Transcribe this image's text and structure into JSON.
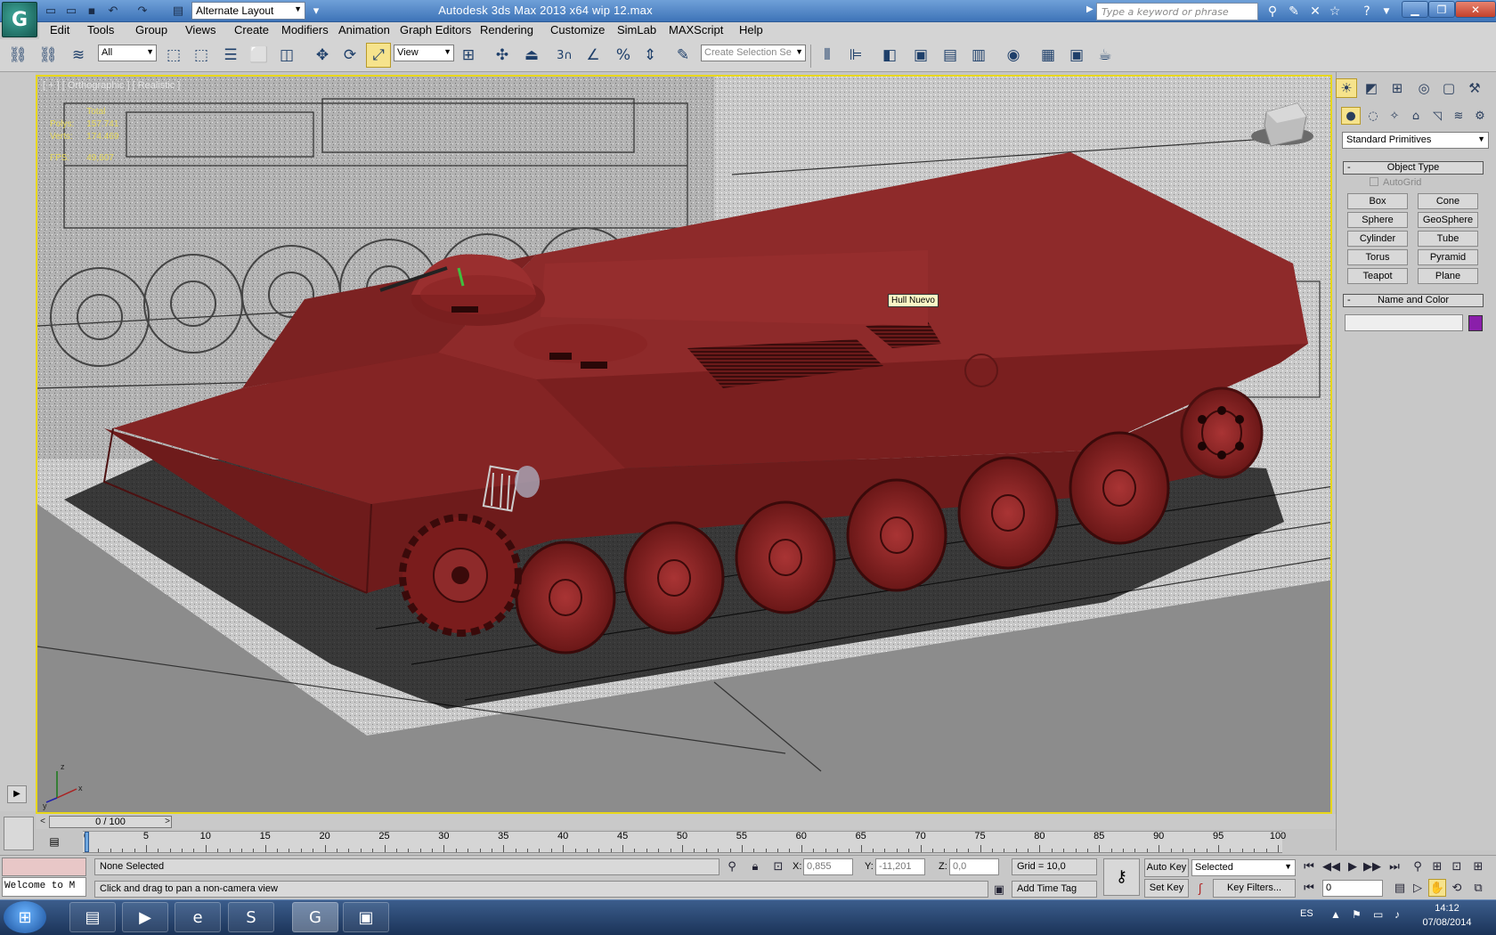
{
  "window": {
    "title": "Autodesk 3ds Max  2013 x64       wip 12.max",
    "layout": "Alternate Layout",
    "search_placeholder": "Type a keyword or phrase"
  },
  "menu": [
    "Edit",
    "Tools",
    "Group",
    "Views",
    "Create",
    "Modifiers",
    "Animation",
    "Graph Editors",
    "Rendering",
    "Customize",
    "SimLab",
    "MAXScript",
    "Help"
  ],
  "toolbar": {
    "filter": "All",
    "ref_coord": "View",
    "selection_set_placeholder": "Create Selection Se",
    "snap_value": "3"
  },
  "viewport": {
    "label": "[ + ] [ Orthographic ] [ Realistic ]",
    "stats": {
      "header": "Total",
      "polys_label": "Polys:",
      "polys": "157.741",
      "verts_label": "Verts:",
      "verts": "174.469",
      "fps_label": "FPS:",
      "fps": "49,607"
    },
    "tooltip": "Hull Nuevo",
    "colors": {
      "hull": "#8e2a2a",
      "border": "#e8d71b"
    }
  },
  "command_panel": {
    "category": "Standard Primitives",
    "object_type_title": "Object Type",
    "autogrid": "AutoGrid",
    "primitives": [
      "Box",
      "Cone",
      "Sphere",
      "GeoSphere",
      "Cylinder",
      "Tube",
      "Torus",
      "Pyramid",
      "Teapot",
      "Plane"
    ],
    "name_color_title": "Name and Color",
    "object_color": "#8a1faa"
  },
  "timeline": {
    "slider": "0 / 100",
    "ticks": [
      "0",
      "5",
      "10",
      "15",
      "20",
      "25",
      "30",
      "35",
      "40",
      "45",
      "50",
      "55",
      "60",
      "65",
      "70",
      "75",
      "80",
      "85",
      "90",
      "95",
      "100"
    ]
  },
  "status": {
    "maxscript": "Welcome to M",
    "selection": "None Selected",
    "prompt": "Click and drag to pan a non-camera view",
    "x_label": "X:",
    "x": "0,855",
    "y_label": "Y:",
    "y": "-11,201",
    "z_label": "Z:",
    "z": "0,0",
    "grid": "Grid = 10,0",
    "add_time_tag": "Add Time Tag",
    "auto_key": "Auto Key",
    "set_key": "Set Key",
    "key_mode": "Selected",
    "key_filters": "Key Filters...",
    "frame": "0"
  },
  "taskbar": {
    "lang": "ES",
    "time": "14:12",
    "date": "07/08/2014"
  }
}
